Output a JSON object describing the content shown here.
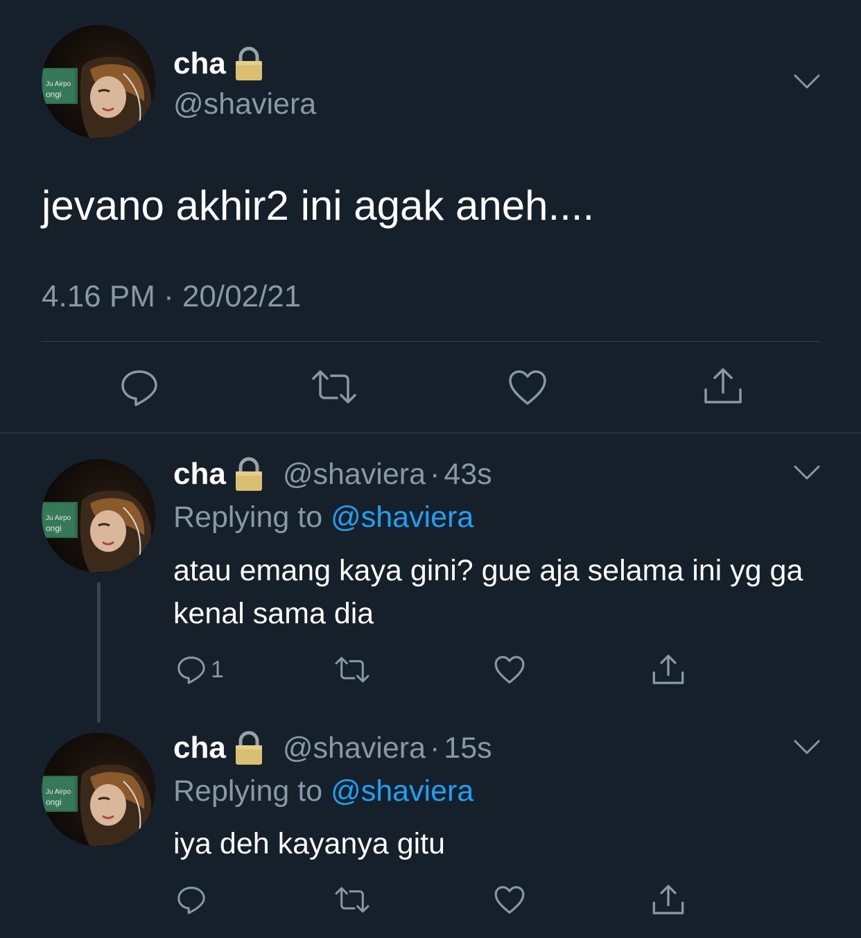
{
  "main_tweet": {
    "display_name": "cha",
    "handle": "@shaviera",
    "text": "jevano akhir2 ini agak aneh....",
    "timestamp": "4.16 PM · 20/02/21",
    "icons": [
      "lock-icon",
      "chevron-down-icon",
      "reply-icon",
      "retweet-icon",
      "like-icon",
      "share-icon"
    ]
  },
  "replies": [
    {
      "display_name": "cha",
      "handle": "@shaviera",
      "separator": "·",
      "age": "43s",
      "replying_prefix": "Replying to ",
      "replying_to": "@shaviera",
      "text": "atau emang kaya gini? gue aja selama ini yg ga kenal sama dia",
      "reply_count": "1"
    },
    {
      "display_name": "cha",
      "handle": "@shaviera",
      "separator": "·",
      "age": "15s",
      "replying_prefix": "Replying to ",
      "replying_to": "@shaviera",
      "text": "iya deh kayanya gitu",
      "reply_count": ""
    }
  ],
  "colors": {
    "background": "#15202b",
    "secondary_text": "#8899a6",
    "link": "#1da1f2",
    "divider": "#38444d"
  }
}
